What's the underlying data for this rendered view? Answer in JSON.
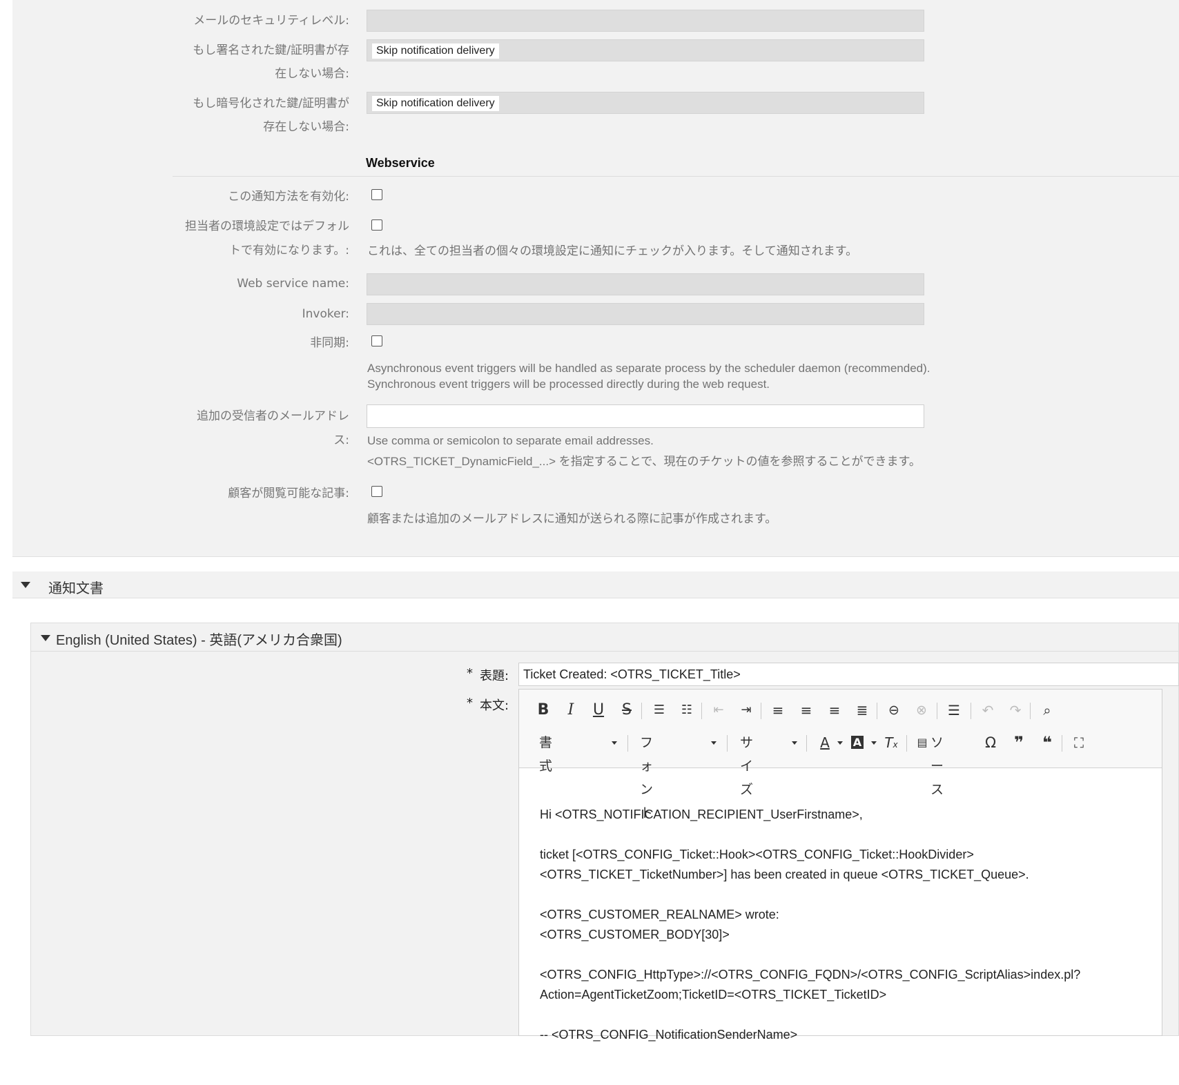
{
  "email_security": {
    "level_label": "メールのセキュリティレベル:",
    "signed_label_1": "もし署名された鍵/証明書が存",
    "signed_label_2": "在しない場合:",
    "signed_value": "Skip notification delivery",
    "encrypted_label_1": "もし暗号化された鍵/証明書が",
    "encrypted_label_2": "存在しない場合:",
    "encrypted_value": "Skip notification delivery"
  },
  "webservice": {
    "heading": "Webservice",
    "enable_label": "この通知方法を有効化:",
    "default_label_1": "担当者の環境設定ではデフォル",
    "default_label_2": "トで有効になります。:",
    "default_desc": "これは、全ての担当者の個々の環境設定に通知にチェックが入ります。そして通知されます。",
    "name_label": "Web service name:",
    "invoker_label": "Invoker:",
    "async_label": "非同期:",
    "async_desc_1": "Asynchronous event triggers will be handled as separate process by the scheduler daemon (recommended).",
    "async_desc_2": "Synchronous event triggers will be processed directly during the web request.",
    "addr_label_1": "追加の受信者のメールアドレ",
    "addr_label_2": "ス:",
    "addr_desc_1": "Use comma or semicolon to separate email addresses.",
    "addr_desc_2": "<OTRS_TICKET_DynamicField_...> を指定することで、現在のチケットの値を参照することができます。",
    "visible_label": "顧客が閲覧可能な記事:",
    "visible_desc": "顧客または追加のメールアドレスに通知が送られる際に記事が作成されます。"
  },
  "notification_text": {
    "section_title": "通知文書",
    "language_title": "English (United States) - 英語(アメリカ合衆国)",
    "subject_label": "表題:",
    "subject_value": "Ticket Created: <OTRS_TICKET_Title>",
    "body_label": "本文:",
    "required_mark": "*",
    "toolbar": {
      "format": "書式",
      "font": "フォント",
      "size": "サイズ",
      "source": "ソース"
    },
    "body_lines": [
      "Hi <OTRS_NOTIFICATION_RECIPIENT_UserFirstname>,",
      "",
      "ticket [<OTRS_CONFIG_Ticket::Hook><OTRS_CONFIG_Ticket::HookDivider>",
      "<OTRS_TICKET_TicketNumber>] has been created in queue <OTRS_TICKET_Queue>.",
      "",
      "<OTRS_CUSTOMER_REALNAME> wrote:",
      "<OTRS_CUSTOMER_BODY[30]>",
      "",
      "<OTRS_CONFIG_HttpType>://<OTRS_CONFIG_FQDN>/<OTRS_CONFIG_ScriptAlias>index.pl?",
      "Action=AgentTicketZoom;TicketID=<OTRS_TICKET_TicketID>",
      "",
      "-- <OTRS_CONFIG_NotificationSenderName>"
    ]
  }
}
